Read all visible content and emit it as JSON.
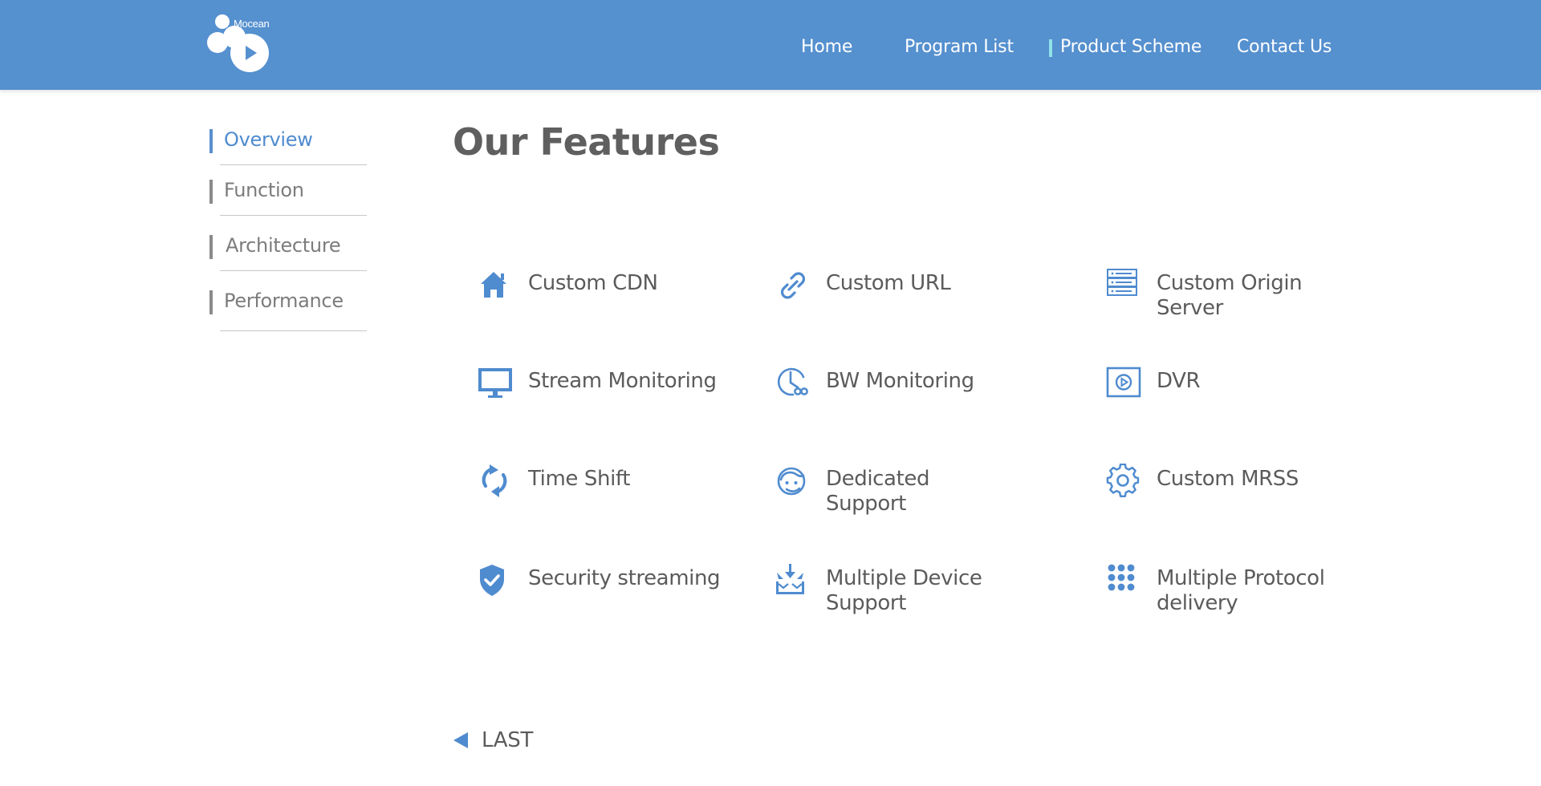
{
  "header": {
    "brand": "Mocean",
    "nav": [
      {
        "label": "Home"
      },
      {
        "label": "Program List"
      },
      {
        "label": "Product Scheme"
      },
      {
        "label": "Contact Us"
      }
    ],
    "active_nav_index": 2
  },
  "sidebar": {
    "items": [
      {
        "label": "Overview"
      },
      {
        "label": "Function"
      },
      {
        "label": "Architecture"
      },
      {
        "label": "Performance"
      }
    ],
    "active_index": 0
  },
  "main": {
    "title": "Our Features",
    "features": [
      {
        "label": "Custom CDN",
        "icon": "home-icon"
      },
      {
        "label": "Custom URL",
        "icon": "link-icon"
      },
      {
        "label": "Custom Origin Server",
        "icon": "server-icon"
      },
      {
        "label": "Stream Monitoring",
        "icon": "monitor-icon"
      },
      {
        "label": "BW Monitoring",
        "icon": "bandwidth-clock-icon"
      },
      {
        "label": "DVR",
        "icon": "dvr-play-icon"
      },
      {
        "label": "Time Shift",
        "icon": "refresh-icon"
      },
      {
        "label": "Dedicated Support",
        "icon": "support-agent-icon"
      },
      {
        "label": "Custom MRSS",
        "icon": "gear-icon"
      },
      {
        "label": "Security streaming",
        "icon": "shield-check-icon"
      },
      {
        "label": "Multiple Device Support",
        "icon": "download-devices-icon"
      },
      {
        "label": "Multiple Protocol delivery",
        "icon": "dots-grid-icon"
      }
    ],
    "last_label": "LAST"
  },
  "colors": {
    "header_bg": "#5590cf",
    "accent": "#5a8fcf",
    "nav_active_marker": "#8fe3e8",
    "text": "#5b5b5b"
  }
}
